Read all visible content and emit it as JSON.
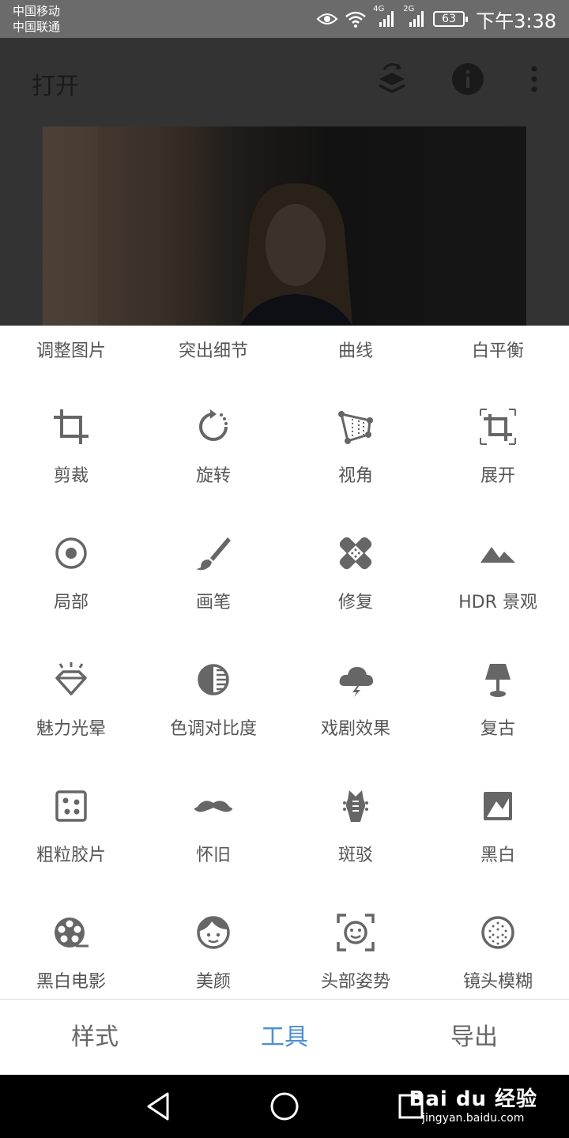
{
  "status_bar": {
    "carrier1": "中国移动",
    "carrier2": "中国联通",
    "net1": "4G",
    "net2": "2G",
    "battery": "63",
    "time": "下午3:38"
  },
  "header": {
    "title": "打开",
    "icons": [
      "layers-refresh-icon",
      "info-icon",
      "more-vert-icon"
    ]
  },
  "panel": {
    "top_row": [
      "调整图片",
      "突出细节",
      "曲线",
      "白平衡"
    ],
    "tools": [
      {
        "label": "剪裁",
        "icon": "crop-icon"
      },
      {
        "label": "旋转",
        "icon": "rotate-icon"
      },
      {
        "label": "视角",
        "icon": "perspective-icon"
      },
      {
        "label": "展开",
        "icon": "expand-icon"
      },
      {
        "label": "局部",
        "icon": "selective-icon"
      },
      {
        "label": "画笔",
        "icon": "brush-icon"
      },
      {
        "label": "修复",
        "icon": "healing-icon"
      },
      {
        "label": "HDR 景观",
        "icon": "hdr-landscape-icon"
      },
      {
        "label": "魅力光晕",
        "icon": "glamour-glow-icon"
      },
      {
        "label": "色调对比度",
        "icon": "tonal-contrast-icon"
      },
      {
        "label": "戏剧效果",
        "icon": "drama-icon"
      },
      {
        "label": "复古",
        "icon": "vintage-lamp-icon"
      },
      {
        "label": "粗粒胶片",
        "icon": "grainy-film-icon"
      },
      {
        "label": "怀旧",
        "icon": "retrolux-mustache-icon"
      },
      {
        "label": "斑驳",
        "icon": "grunge-guitar-icon"
      },
      {
        "label": "黑白",
        "icon": "black-white-icon"
      },
      {
        "label": "黑白电影",
        "icon": "noir-film-reel-icon"
      },
      {
        "label": "美颜",
        "icon": "face-icon"
      },
      {
        "label": "头部姿势",
        "icon": "head-pose-icon"
      },
      {
        "label": "镜头模糊",
        "icon": "lens-blur-icon"
      }
    ]
  },
  "tabs": [
    {
      "label": "样式",
      "active": false
    },
    {
      "label": "工具",
      "active": true
    },
    {
      "label": "导出",
      "active": false
    }
  ],
  "nav": {
    "icons": [
      "back-icon",
      "home-icon",
      "recents-icon"
    ]
  },
  "watermark": {
    "top": "Bai du 经验",
    "bottom": "jingyan.baidu.com"
  },
  "colors": {
    "accent": "#4a8fd6",
    "icon": "#666666",
    "status_bar": "#6b6b6b"
  }
}
